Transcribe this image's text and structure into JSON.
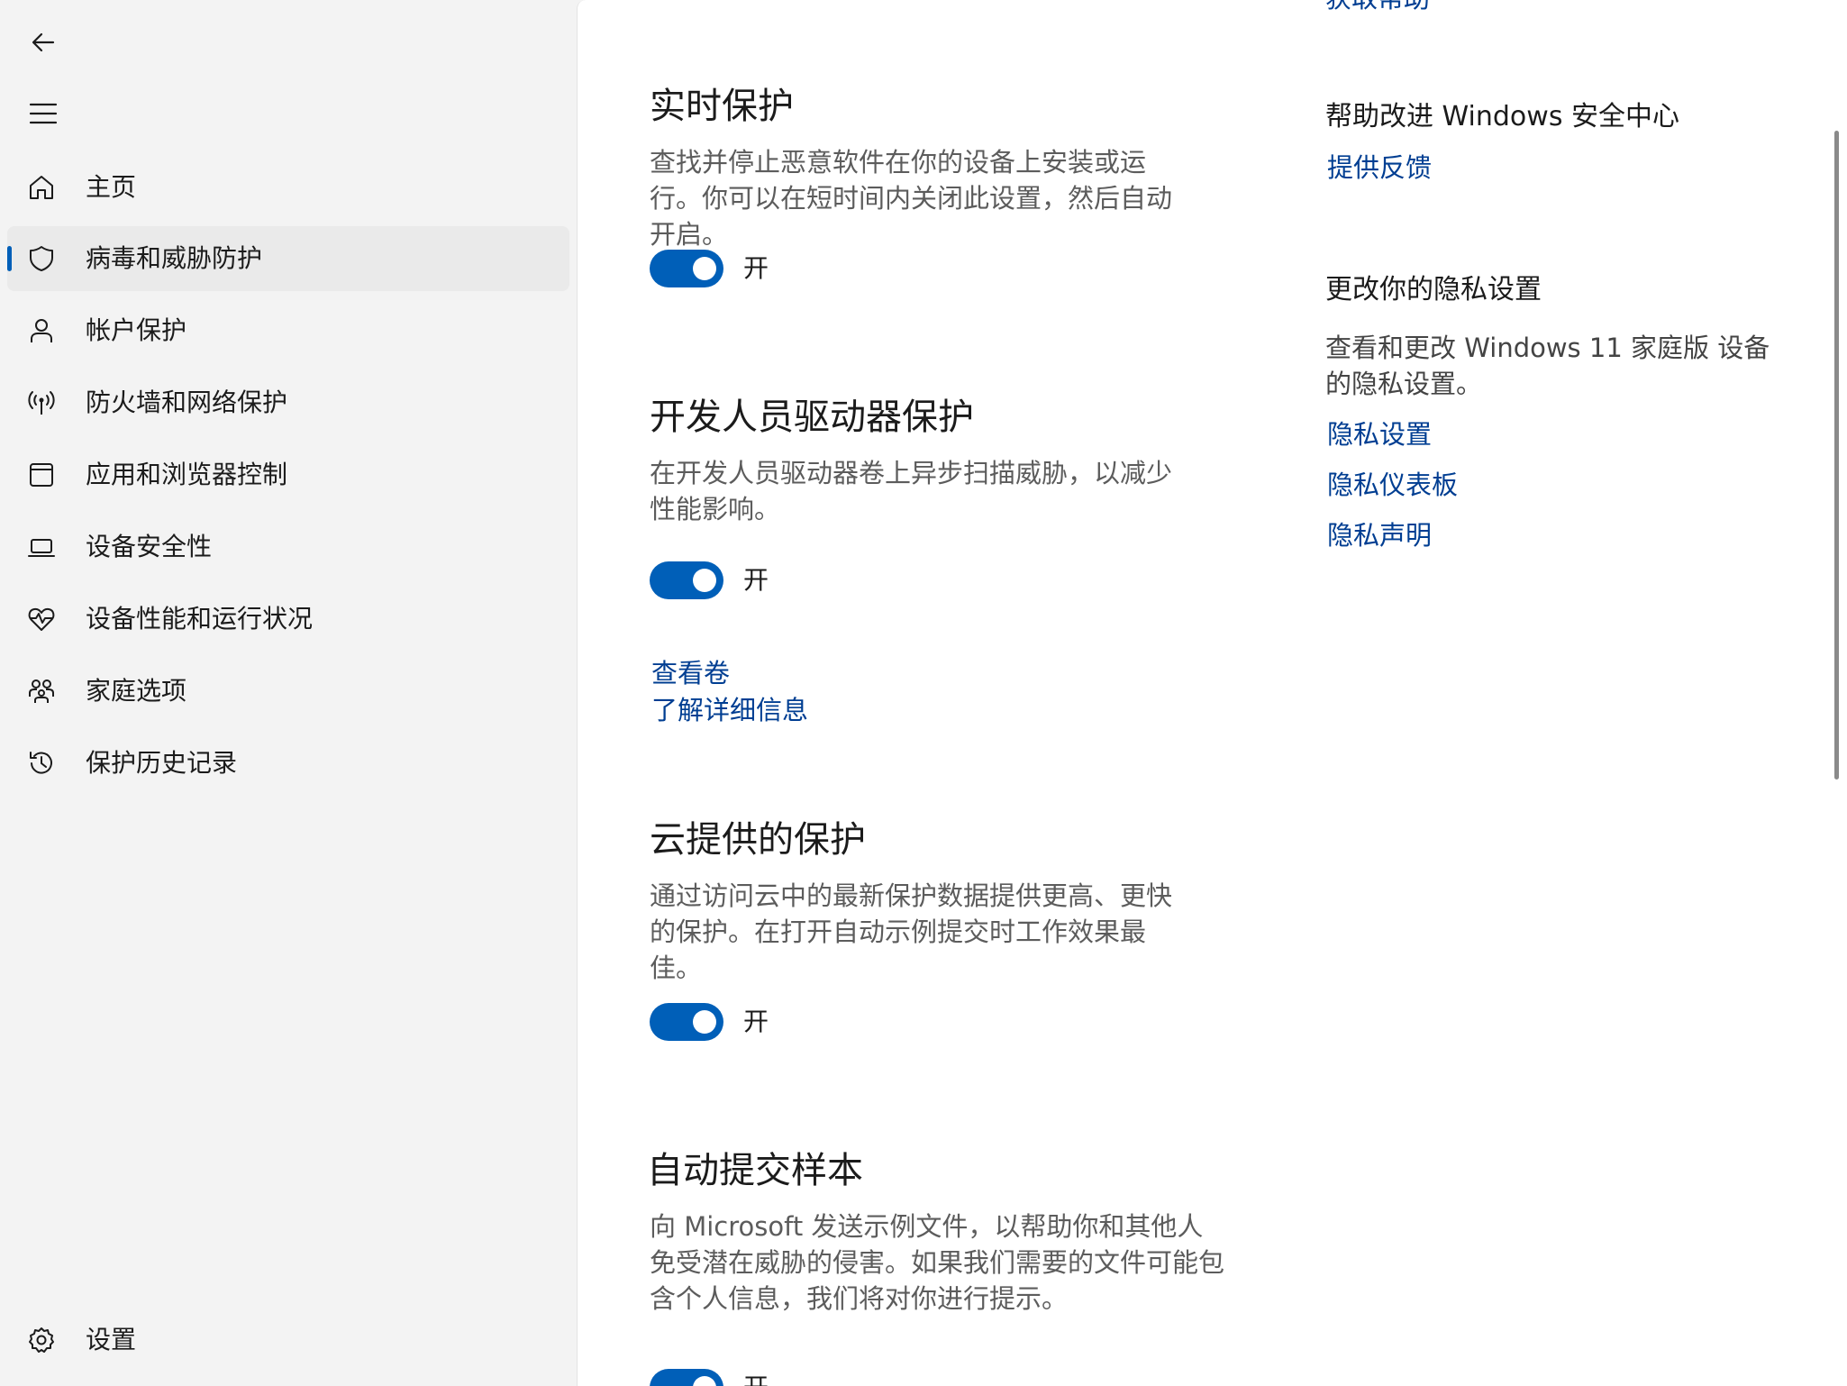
{
  "sidebar": {
    "back_icon": "back-arrow-icon",
    "menu_icon": "hamburger-menu-icon",
    "items": [
      {
        "label": "主页",
        "icon": "home-icon"
      },
      {
        "label": "病毒和威胁防护",
        "icon": "shield-icon",
        "selected": true
      },
      {
        "label": "帐户保护",
        "icon": "person-icon"
      },
      {
        "label": "防火墙和网络保护",
        "icon": "antenna-icon"
      },
      {
        "label": "应用和浏览器控制",
        "icon": "app-window-icon"
      },
      {
        "label": "设备安全性",
        "icon": "laptop-icon"
      },
      {
        "label": "设备性能和运行状况",
        "icon": "heart-pulse-icon"
      },
      {
        "label": "家庭选项",
        "icon": "family-icon"
      },
      {
        "label": "保护历史记录",
        "icon": "history-icon"
      }
    ],
    "settings": {
      "label": "设置",
      "icon": "gear-icon"
    }
  },
  "main": {
    "sections": [
      {
        "title": "实时保护",
        "description": "查找并停止恶意软件在你的设备上安装或运行。你可以在短时间内关闭此设置，然后自动开启。",
        "toggle_state": "开"
      },
      {
        "title": "开发人员驱动器保护",
        "description": "在开发人员驱动器卷上异步扫描威胁，以减少性能影响。",
        "toggle_state": "开",
        "links": [
          "查看卷",
          "了解详细信息"
        ]
      },
      {
        "title": "云提供的保护",
        "description": "通过访问云中的最新保护数据提供更高、更快的保护。在打开自动示例提交时工作效果最佳。",
        "toggle_state": "开"
      },
      {
        "title": "自动提交样本",
        "description": "向 Microsoft 发送示例文件，以帮助你和其他人免受潜在威胁的侵害。如果我们需要的文件可能包含个人信息，我们将对你进行提示。",
        "toggle_state": "开"
      }
    ]
  },
  "side_panel": {
    "top_link_partial": "获取帮助",
    "improve_heading": "帮助改进 Windows 安全中心",
    "feedback_link": "提供反馈",
    "privacy_heading": "更改你的隐私设置",
    "privacy_description": "查看和更改 Windows 11 家庭版 设备的隐私设置。",
    "privacy_links": [
      "隐私设置",
      "隐私仪表板",
      "隐私声明"
    ]
  },
  "colors": {
    "accent": "#005fb8",
    "link": "#003e92",
    "sidebar_bg": "#f3f3f3",
    "content_bg": "#ffffff"
  }
}
